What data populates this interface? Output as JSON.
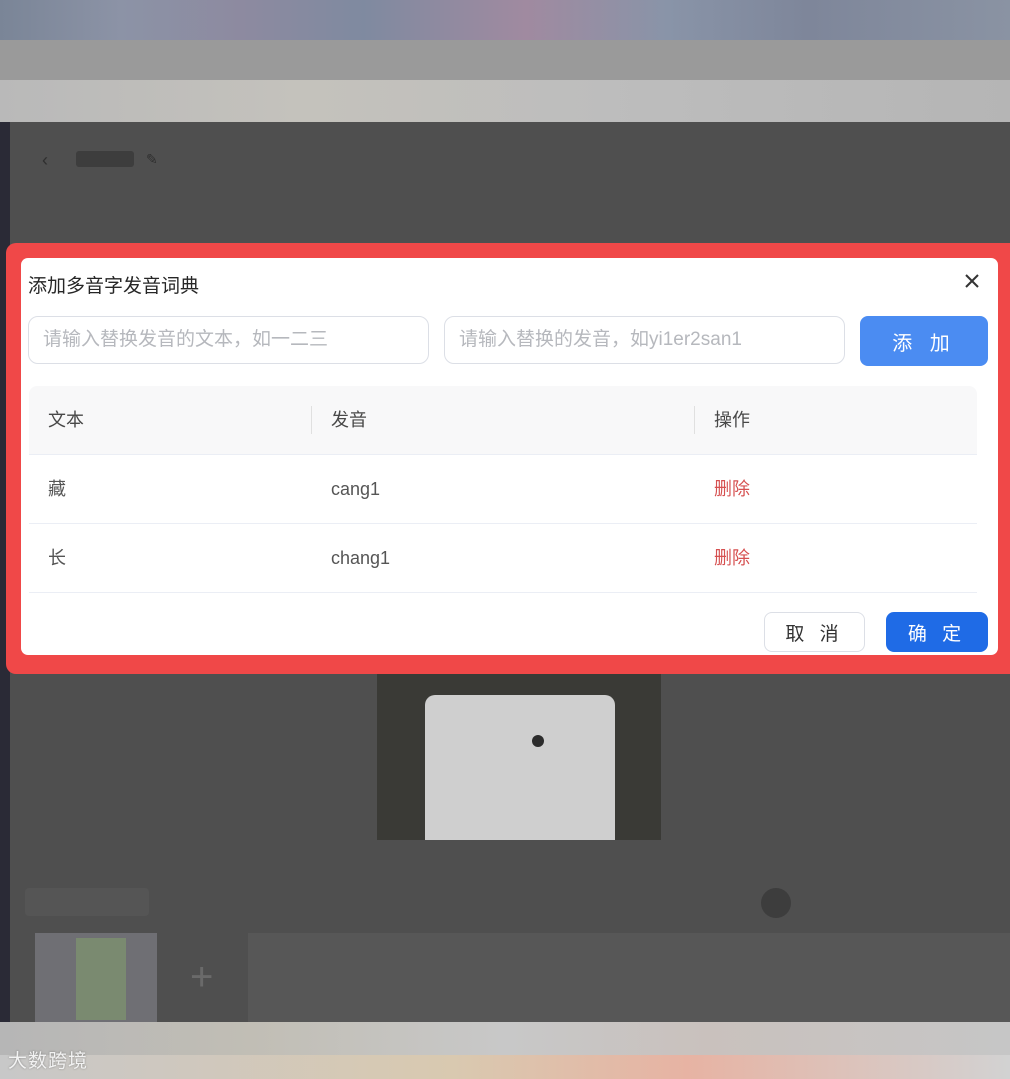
{
  "dialog": {
    "title": "添加多音字发音词典",
    "text_input_placeholder": "请输入替换发音的文本，如一二三",
    "pron_input_placeholder": "请输入替换的发音，如yi1er2san1",
    "add_label": "添 加",
    "cancel_label": "取 消",
    "confirm_label": "确 定",
    "close_icon": "close-icon"
  },
  "table": {
    "headers": [
      "文本",
      "发音",
      "操作"
    ],
    "rows": [
      {
        "text": "藏",
        "pronunciation": "cang1",
        "action": "删除"
      },
      {
        "text": "长",
        "pronunciation": "chang1",
        "action": "删除"
      }
    ]
  },
  "watermark": "大数跨境",
  "colors": {
    "highlight_border": "#f04848",
    "add_button": "#4b8cf2",
    "confirm_button": "#1f6be6",
    "delete_link": "#d65050"
  }
}
